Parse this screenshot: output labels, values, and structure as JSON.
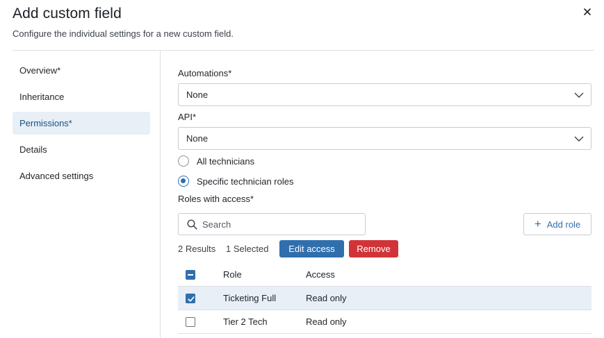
{
  "dialog": {
    "title": "Add custom field",
    "subtitle": "Configure the individual settings for a new custom field."
  },
  "sidebar": {
    "items": [
      {
        "label": "Overview*",
        "active": false
      },
      {
        "label": "Inheritance",
        "active": false
      },
      {
        "label": "Permissions*",
        "active": true
      },
      {
        "label": "Details",
        "active": false
      },
      {
        "label": "Advanced settings",
        "active": false
      }
    ]
  },
  "form": {
    "automations": {
      "label": "Automations*",
      "value": "None"
    },
    "api": {
      "label": "API*",
      "value": "None"
    },
    "radio_all": {
      "label": "All technicians",
      "checked": false
    },
    "radio_specific": {
      "label": "Specific technician roles",
      "checked": true
    },
    "roles_label": "Roles with access*",
    "search_placeholder": "Search",
    "add_role_label": "Add role",
    "results_text": "2 Results",
    "selected_text": "1 Selected",
    "edit_access_label": "Edit access",
    "remove_label": "Remove"
  },
  "table": {
    "headers": {
      "role": "Role",
      "access": "Access"
    },
    "rows": [
      {
        "role": "Ticketing Full",
        "access": "Read only",
        "checked": true
      },
      {
        "role": "Tier 2 Tech",
        "access": "Read only",
        "checked": false
      }
    ]
  },
  "colors": {
    "accent": "#2f6fad",
    "danger": "#d13438",
    "selected_bg": "#e8eff7"
  }
}
